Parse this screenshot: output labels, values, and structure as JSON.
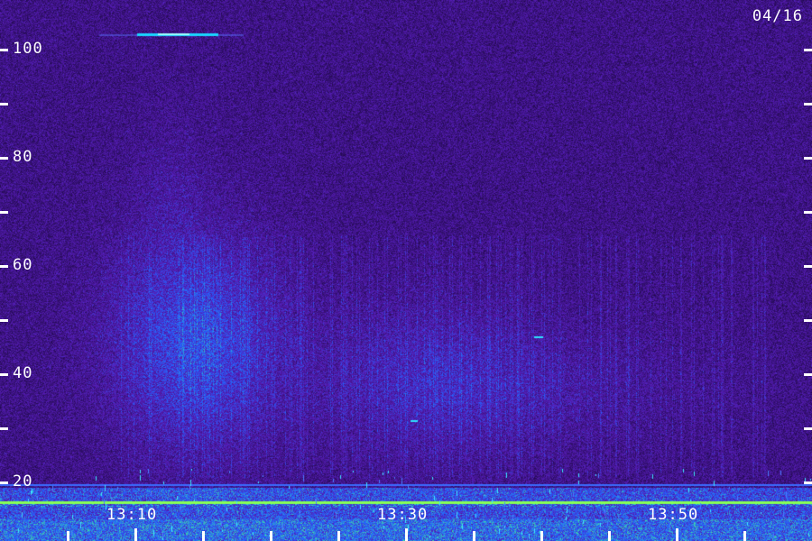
{
  "date_label": "04/16",
  "y_ticks": [
    {
      "label": "100",
      "value": 100
    },
    {
      "label": "",
      "value": 90
    },
    {
      "label": "80",
      "value": 80
    },
    {
      "label": "",
      "value": 70
    },
    {
      "label": "60",
      "value": 60
    },
    {
      "label": "",
      "value": 50
    },
    {
      "label": "40",
      "value": 40
    },
    {
      "label": "",
      "value": 30
    },
    {
      "label": "20",
      "value": 20
    }
  ],
  "x_ticks": [
    {
      "label": "13:10"
    },
    {
      "label": "13:30"
    },
    {
      "label": "13:50"
    }
  ],
  "colors": {
    "background": "#2a0f58",
    "noise_mid": "#4b1fb0",
    "signal_blue": "#2d5cff",
    "signal_green": "#66ff55",
    "text": "#ffffff"
  }
}
